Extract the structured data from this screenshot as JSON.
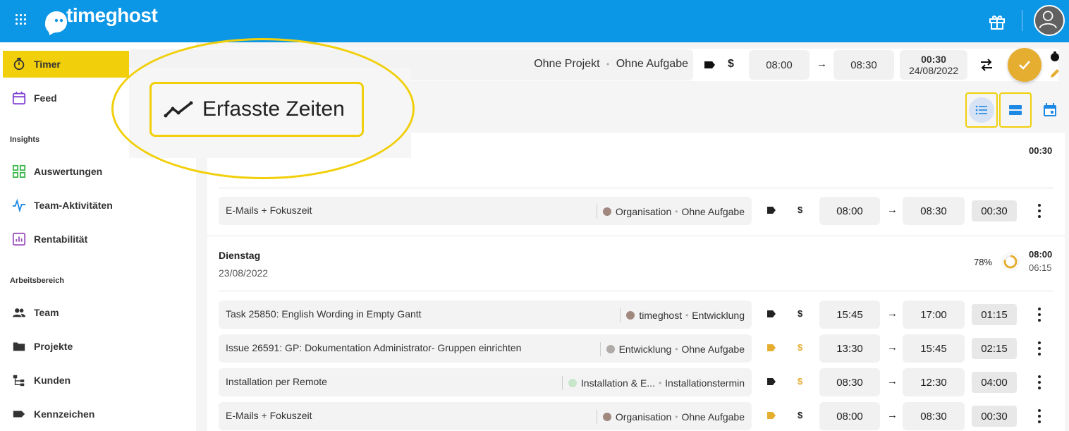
{
  "app": {
    "logo_text": "timeghost"
  },
  "sidebar": {
    "items": [
      {
        "label": "Timer",
        "icon": "stopwatch-icon"
      },
      {
        "label": "Feed",
        "icon": "calendar-icon"
      }
    ],
    "insights_label": "Insights",
    "insights": [
      {
        "label": "Auswertungen",
        "icon": "dashboard-icon"
      },
      {
        "label": "Team-Aktivitäten",
        "icon": "activity-icon"
      },
      {
        "label": "Rentabilität",
        "icon": "chart-icon"
      }
    ],
    "workspace_label": "Arbeitsbereich",
    "workspace": [
      {
        "label": "Team",
        "icon": "people-icon"
      },
      {
        "label": "Projekte",
        "icon": "folder-icon"
      },
      {
        "label": "Kunden",
        "icon": "hierarchy-icon"
      },
      {
        "label": "Kennzeichen",
        "icon": "tag-icon"
      }
    ]
  },
  "timer": {
    "project": "Ohne Projekt",
    "task": "Ohne Aufgabe",
    "bullet": "•",
    "dollar": "$",
    "start": "08:00",
    "end": "08:30",
    "arrow": "→",
    "duration": "00:30",
    "date": "24/08/2022"
  },
  "callout": {
    "title": "Erfasste Zeiten"
  },
  "groups": [
    {
      "total": "00:30"
    },
    {
      "day": "Dienstag",
      "date": "23/08/2022",
      "percent": "78%",
      "total": "08:00",
      "target": "06:15"
    }
  ],
  "entries": [
    {
      "desc": "E-Mails + Fokuszeit",
      "dot_color": "#a1887f",
      "project": "Organisation",
      "task": "Ohne Aufgabe",
      "tag_color": "#222222",
      "dollar_color": "#222222",
      "start": "08:00",
      "end": "08:30",
      "duration": "00:30"
    },
    {
      "desc": "Task 25850: English Wording in Empty Gantt",
      "dot_color": "#a1887f",
      "project": "timeghost",
      "task": "Entwicklung",
      "tag_color": "#222222",
      "dollar_color": "#222222",
      "start": "15:45",
      "end": "17:00",
      "duration": "01:15"
    },
    {
      "desc": "Issue 26591: GP: Dokumentation Administrator- Gruppen einrichten",
      "dot_color": "#b0aaa8",
      "project": "Entwicklung",
      "task": "Ohne Aufgabe",
      "tag_color": "#e5ae31",
      "dollar_color": "#e5ae31",
      "start": "13:30",
      "end": "15:45",
      "duration": "02:15"
    },
    {
      "desc": "Installation per Remote",
      "dot_color": "#c8e6c9",
      "project": "Installation & E...",
      "task": "Installationstermin",
      "tag_color": "#222222",
      "dollar_color": "#e5ae31",
      "start": "08:30",
      "end": "12:30",
      "duration": "04:00"
    },
    {
      "desc": "E-Mails + Fokuszeit",
      "dot_color": "#a1887f",
      "project": "Organisation",
      "task": "Ohne Aufgabe",
      "tag_color": "#e5ae31",
      "dollar_color": "#222222",
      "start": "08:00",
      "end": "08:30",
      "duration": "00:30"
    }
  ],
  "colors": {
    "brand": "#0c96e6",
    "accent": "#f1cf0b",
    "check": "#e5ae31"
  }
}
